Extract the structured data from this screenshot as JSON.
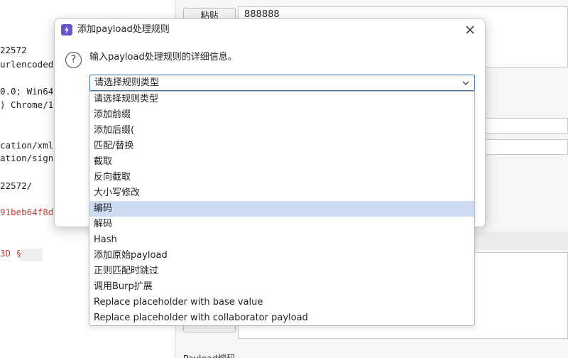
{
  "background": {
    "request_lines": [
      "22572",
      "urlencoded",
      "0.0; Win64",
      ") Chrome/1",
      "cation/xml",
      "ation/sign",
      "22572/",
      "91beb64f8d",
      "3D §"
    ],
    "paste_button": "粘贴",
    "payload_list_items": [
      "888888"
    ],
    "bottom_label": "Payload编码"
  },
  "dialog": {
    "title": "添加payload处理规则",
    "message": "输入payload处理规则的详细信息。",
    "select": {
      "value": "请选择规则类型",
      "options": [
        "请选择规则类型",
        "添加前缀",
        "添加后缀(",
        "匹配/替换",
        "截取",
        "反向截取",
        "大小写修改",
        "编码",
        "解码",
        "Hash",
        "添加原始payload",
        "正则匹配时跳过",
        "调用Burp扩展",
        "Replace placeholder with base value",
        "Replace placeholder with collaborator payload"
      ],
      "highlighted": "编码"
    }
  },
  "icons": {
    "app": "burp-logo-icon",
    "close": "close-icon",
    "question": "question-icon",
    "caret": "chevron-down-icon"
  },
  "colors": {
    "accent": "#6654c9",
    "highlight": "#cddcf2",
    "select_border": "#3f74b8",
    "red_text": "#c4403c"
  }
}
